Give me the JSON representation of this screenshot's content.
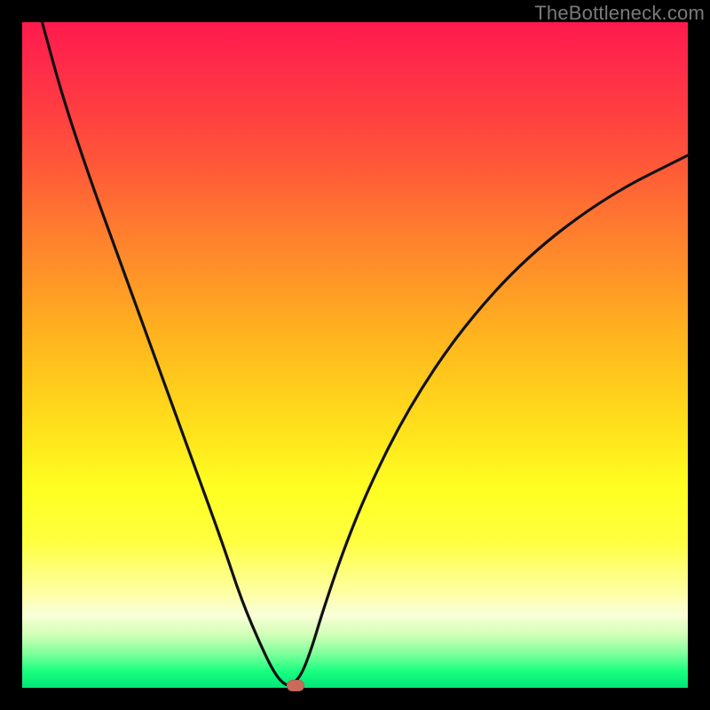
{
  "watermark": "TheBottleneck.com",
  "colors": {
    "frame": "#000000",
    "curve_stroke": "#111111",
    "marker_fill": "#c96a5a"
  },
  "chart_data": {
    "type": "line",
    "title": "",
    "xlabel": "",
    "ylabel": "",
    "xlim": [
      0,
      100
    ],
    "ylim": [
      0,
      100
    ],
    "grid": false,
    "legend": false,
    "note": "V-shaped bottleneck curve. Values estimated from pixel positions relative to plot area. x and y are percentages (0 = left/bottom, 100 = right/top).",
    "series": [
      {
        "name": "bottleneck-curve",
        "x": [
          3,
          6,
          10,
          14,
          18,
          22,
          26,
          30,
          33,
          36,
          38,
          39.5,
          40.5,
          42,
          43.5,
          45,
          48,
          52,
          58,
          66,
          76,
          88,
          100
        ],
        "y": [
          100,
          89,
          77,
          66,
          55,
          44,
          33,
          22,
          13,
          6,
          2,
          0.4,
          0.4,
          2,
          6,
          11,
          20,
          30,
          42,
          54,
          65,
          74,
          80
        ]
      }
    ],
    "flat_bottom": {
      "x_start": 39.5,
      "x_end": 40.5,
      "y": 0.4
    },
    "marker": {
      "x": 41,
      "y": 0,
      "shape": "rounded-rect"
    }
  }
}
